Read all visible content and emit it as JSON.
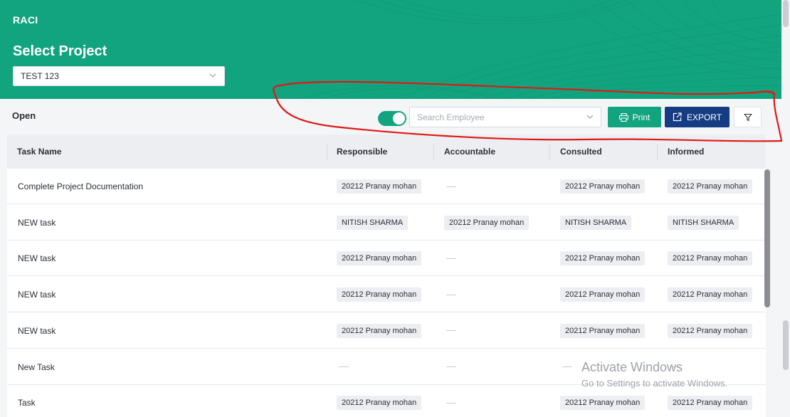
{
  "app": {
    "title": "RACI"
  },
  "header": {
    "page_title": "Select Project",
    "project_value": "TEST 123"
  },
  "toolbar": {
    "status_label": "Open",
    "search_placeholder": "Search Employee",
    "print_label": "Print",
    "export_label": "EXPORT"
  },
  "table": {
    "columns": [
      "Task Name",
      "Responsible",
      "Accountable",
      "Consulted",
      "Informed"
    ],
    "rows": [
      {
        "task": "Complete Project Documentation",
        "responsible": "20212 Pranay mohan",
        "accountable": "",
        "consulted": "20212 Pranay mohan",
        "informed": "20212 Pranay mohan"
      },
      {
        "task": "NEW task",
        "responsible": "NITISH SHARMA",
        "accountable": "20212 Pranay mohan",
        "consulted": "NITISH SHARMA",
        "informed": "NITISH SHARMA"
      },
      {
        "task": "NEW task",
        "responsible": "20212 Pranay mohan",
        "accountable": "",
        "consulted": "20212 Pranay mohan",
        "informed": "20212 Pranay mohan"
      },
      {
        "task": "NEW task",
        "responsible": "20212 Pranay mohan",
        "accountable": "",
        "consulted": "20212 Pranay mohan",
        "informed": "20212 Pranay mohan"
      },
      {
        "task": "NEW task",
        "responsible": "20212 Pranay mohan",
        "accountable": "",
        "consulted": "20212 Pranay mohan",
        "informed": "20212 Pranay mohan"
      },
      {
        "task": "New Task",
        "responsible": "",
        "accountable": "",
        "consulted": "",
        "informed": ""
      },
      {
        "task": "Task",
        "responsible": "20212 Pranay mohan",
        "accountable": "",
        "consulted": "20212 Pranay mohan",
        "informed": "20212 Pranay mohan"
      }
    ]
  },
  "watermark": {
    "line1": "Activate Windows",
    "line2": "Go to Settings to activate Windows."
  },
  "colors": {
    "brand_green": "#12a47f",
    "export_blue": "#163d84",
    "annotation_red": "#e01818"
  }
}
